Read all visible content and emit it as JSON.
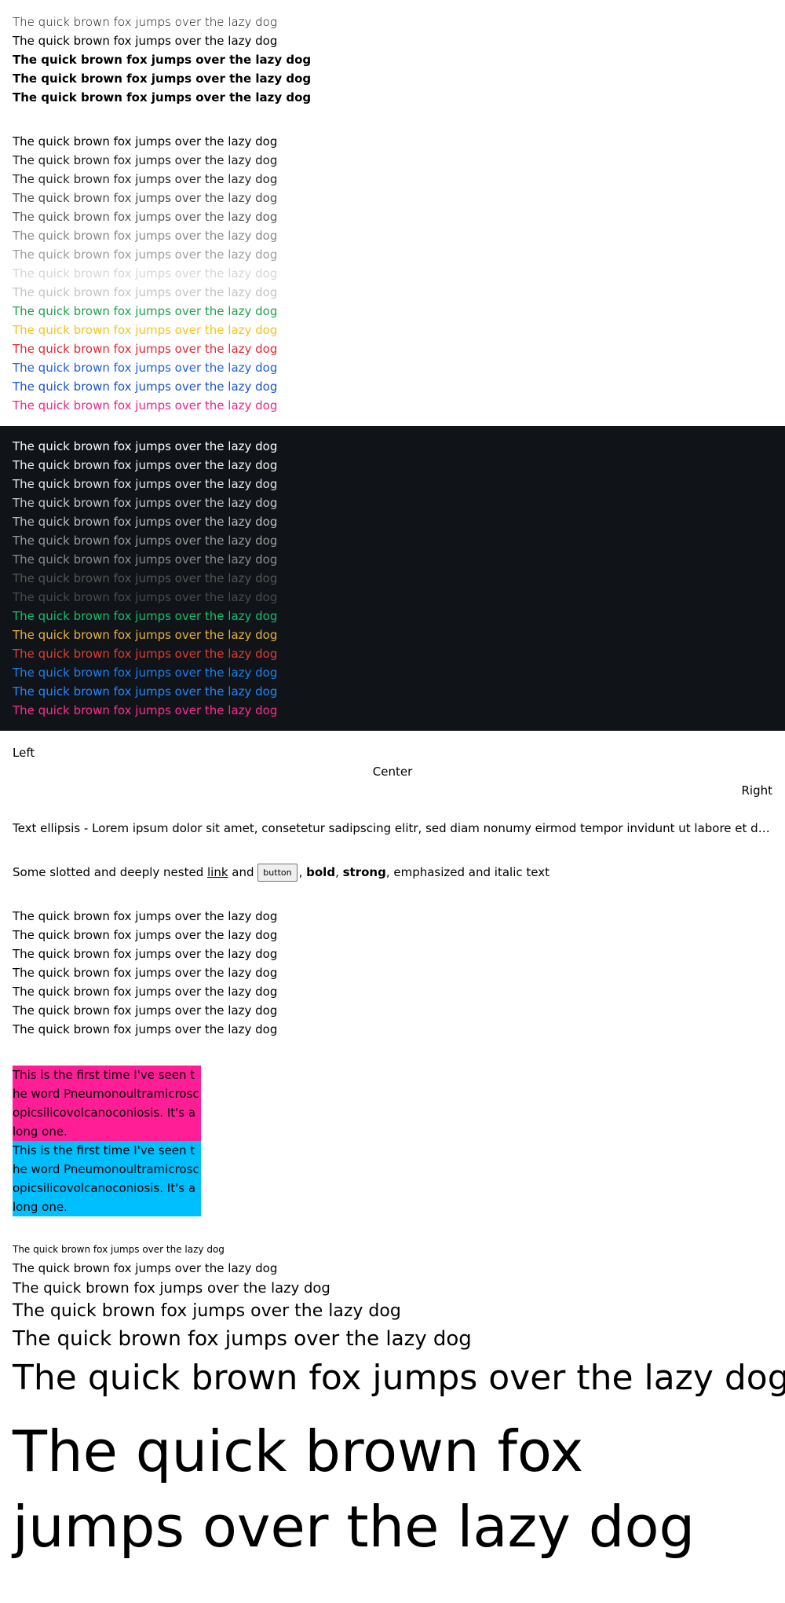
{
  "weights": {
    "lines": [
      "The quick brown fox jumps over the lazy dog",
      "The quick brown fox jumps over the lazy dog",
      "The quick brown fox jumps over the lazy dog",
      "The quick brown fox jumps over the lazy dog",
      "The quick brown fox jumps over the lazy dog"
    ]
  },
  "light_colors": {
    "lines": [
      {
        "text": "The quick brown fox jumps over the lazy dog",
        "color": "#000000"
      },
      {
        "text": "The quick brown fox jumps over the lazy dog",
        "color": "#1a1a1a"
      },
      {
        "text": "The quick brown fox jumps over the lazy dog",
        "color": "#262626"
      },
      {
        "text": "The quick brown fox jumps over the lazy dog",
        "color": "#4d4d4d"
      },
      {
        "text": "The quick brown fox jumps over the lazy dog",
        "color": "#5a5a5a"
      },
      {
        "text": "The quick brown fox jumps over the lazy dog",
        "color": "#8a8a8a"
      },
      {
        "text": "The quick brown fox jumps over the lazy dog",
        "color": "#9e9e9e"
      },
      {
        "text": "The quick brown fox jumps over the lazy dog",
        "color": "#d6d6d6"
      },
      {
        "text": "The quick brown fox jumps over the lazy dog",
        "color": "#c4c4c4"
      },
      {
        "text": "The quick brown fox jumps over the lazy dog",
        "color": "#1fa34a"
      },
      {
        "text": "The quick brown fox jumps over the lazy dog",
        "color": "#f7c31a"
      },
      {
        "text": "The quick brown fox jumps over the lazy dog",
        "color": "#e02a36"
      },
      {
        "text": "The quick brown fox jumps over the lazy dog",
        "color": "#2260e0"
      },
      {
        "text": "The quick brown fox jumps over the lazy dog",
        "color": "#1a55cc"
      },
      {
        "text": "The quick brown fox jumps over the lazy dog",
        "color": "#e62a8a"
      }
    ]
  },
  "dark_colors": {
    "background": "#101418",
    "lines": [
      {
        "text": "The quick brown fox jumps over the lazy dog",
        "color": "#ffffff"
      },
      {
        "text": "The quick brown fox jumps over the lazy dog",
        "color": "#f0f0f0"
      },
      {
        "text": "The quick brown fox jumps over the lazy dog",
        "color": "#e6e6e6"
      },
      {
        "text": "The quick brown fox jumps over the lazy dog",
        "color": "#c8c8c8"
      },
      {
        "text": "The quick brown fox jumps over the lazy dog",
        "color": "#bdbdbd"
      },
      {
        "text": "The quick brown fox jumps over the lazy dog",
        "color": "#9a9a9a"
      },
      {
        "text": "The quick brown fox jumps over the lazy dog",
        "color": "#8a8a8a"
      },
      {
        "text": "The quick brown fox jumps over the lazy dog",
        "color": "#555555"
      },
      {
        "text": "The quick brown fox jumps over the lazy dog",
        "color": "#4a4a4a"
      },
      {
        "text": "The quick brown fox jumps over the lazy dog",
        "color": "#0fbf6a"
      },
      {
        "text": "The quick brown fox jumps over the lazy dog",
        "color": "#e6b13a"
      },
      {
        "text": "The quick brown fox jumps over the lazy dog",
        "color": "#e23b30"
      },
      {
        "text": "The quick brown fox jumps over the lazy dog",
        "color": "#1a7ff0"
      },
      {
        "text": "The quick brown fox jumps over the lazy dog",
        "color": "#1f88ff"
      },
      {
        "text": "The quick brown fox jumps over the lazy dog",
        "color": "#ff2a8f"
      }
    ]
  },
  "alignment": {
    "left": "Left",
    "center": "Center",
    "right": "Right"
  },
  "ellipsis": {
    "text": "Text ellipsis - Lorem ipsum dolor sit amet, consetetur sadipscing elitr, sed diam nonumy eirmod tempor invidunt ut labore et dolore magna aliquyam erat, sed diam voluptua."
  },
  "slotted": {
    "prefix": "Some slotted and deeply nested ",
    "link": "link",
    "and": " and ",
    "button": "button",
    "comma1": ", ",
    "bold": "bold",
    "comma2": ", ",
    "strong": "strong",
    "suffix": ", emphasized and italic text"
  },
  "plain": {
    "lines": [
      "The quick brown fox jumps over the lazy dog",
      "The quick brown fox jumps over the lazy dog",
      "The quick brown fox jumps over the lazy dog",
      "The quick brown fox jumps over the lazy dog",
      "The quick brown fox jumps over the lazy dog",
      "The quick brown fox jumps over the lazy dog",
      "The quick brown fox jumps over the lazy dog"
    ]
  },
  "hyphenation": {
    "pink_color": "#ff1e96",
    "blue_color": "#00bfff",
    "box1": "This is the first time I've seen the word Pneumonoultramicroscopicsilicovolcanoconiosis. It's a long one.",
    "box2": "This is the first time I've seen the word Pneumonoultramicroscopicsilicovolcanoconiosis. It's a long one."
  },
  "sizes": {
    "lines": [
      "The quick brown fox jumps over the lazy dog",
      "The quick brown fox jumps over the lazy dog",
      "The quick brown fox jumps over the lazy dog",
      "The quick brown fox jumps over the lazy dog",
      "The quick brown fox jumps over the lazy dog",
      "The quick brown fox jumps over the lazy dog",
      "The quick brown fox jumps over the lazy dog"
    ]
  }
}
